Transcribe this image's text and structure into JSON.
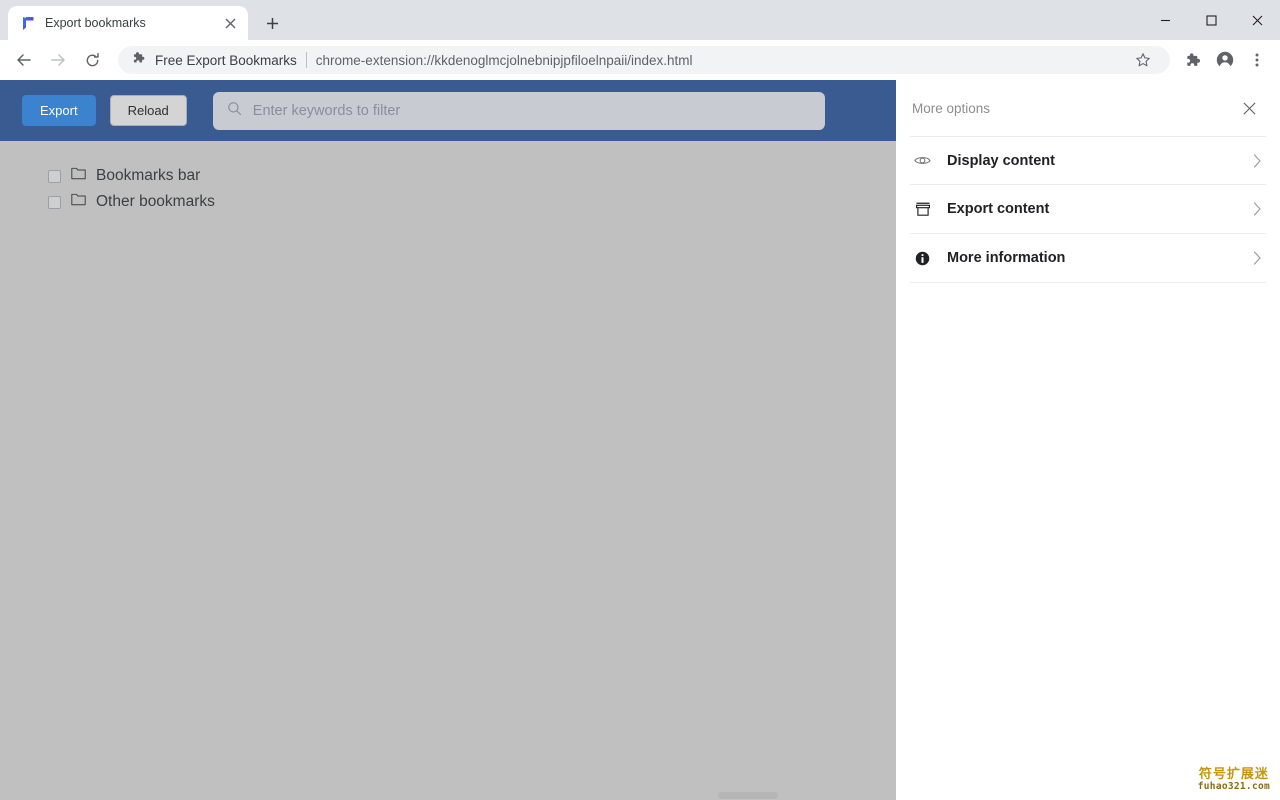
{
  "browser": {
    "tab": {
      "title": "Export bookmarks",
      "favicon_name": "bookmark-flag-icon",
      "close_label": "✕"
    },
    "newtab_label": "+",
    "window_controls": {
      "minimize": "minimize-icon",
      "maximize": "maximize-icon",
      "close": "close-icon"
    },
    "nav": {
      "back": "back-arrow-icon",
      "forward": "forward-arrow-icon",
      "reload": "reload-icon"
    },
    "omnibox": {
      "extension_icon": "puzzle-piece-icon",
      "extension_name": "Free Export Bookmarks",
      "url": "chrome-extension://kkdenoglmcjolnebnipjpfiloelnpaii/index.html"
    },
    "toolbar_icons": {
      "bookmark_star": "star-icon",
      "extensions": "puzzle-piece-icon",
      "profile": "account-avatar-icon",
      "menu": "three-dot-menu-icon"
    }
  },
  "extension_page": {
    "toolbar": {
      "export_label": "Export",
      "reload_label": "Reload",
      "search_placeholder": "Enter keywords to filter",
      "search_value": "",
      "search_icon": "search-icon",
      "background_color": "#3a5a92",
      "export_button_color": "#3b82cf"
    },
    "tree": [
      {
        "label": "Bookmarks bar",
        "checked": false,
        "icon": "folder-icon"
      },
      {
        "label": "Other bookmarks",
        "checked": false,
        "icon": "folder-icon"
      }
    ],
    "background_color": "#c0c0c0"
  },
  "panel": {
    "title": "More options",
    "close_icon": "close-icon",
    "rows": [
      {
        "label": "Display content",
        "icon": "eye-icon",
        "chevron": "chevron-right-icon"
      },
      {
        "label": "Export content",
        "icon": "archive-box-icon",
        "chevron": "chevron-right-icon"
      },
      {
        "label": "More information",
        "icon": "info-circle-icon",
        "chevron": "chevron-right-icon"
      }
    ]
  },
  "watermark": {
    "chinese": "符号扩展迷",
    "latin": "fuhao321.com",
    "color": "#c8960c"
  }
}
